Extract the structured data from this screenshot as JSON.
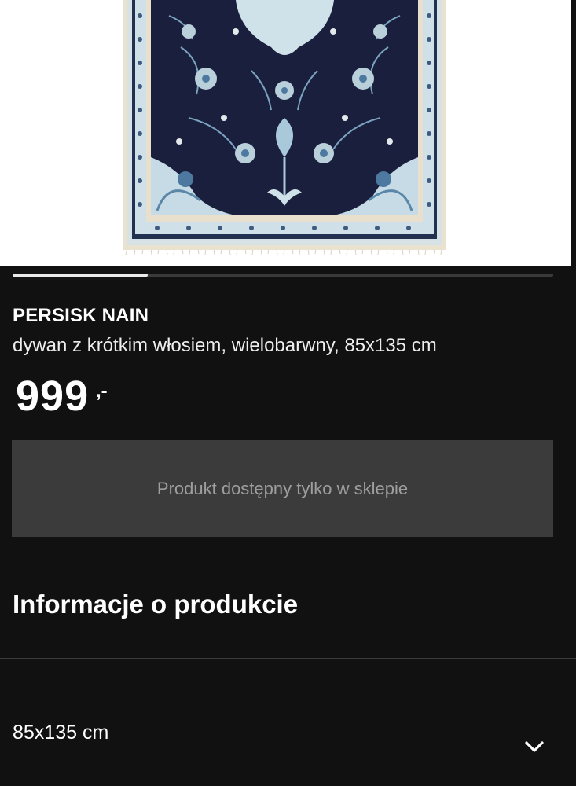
{
  "product": {
    "name": "PERSISK NAIN",
    "description": "dywan z krótkim włosiem, wielobarwny, 85x135 cm",
    "price": "999",
    "price_suffix": ",-"
  },
  "gallery": {
    "image": "rug-photo",
    "progress": 0.25
  },
  "availability": {
    "label": "Produkt dostępny tylko w sklepie"
  },
  "info": {
    "heading": "Informacje o produkcie"
  },
  "size": {
    "label": "85x135 cm",
    "icon": "chevron-down-icon"
  },
  "colors": {
    "background": "#111111",
    "rug_navy": "#1a1f3d",
    "rug_light_blue": "#a9c9db",
    "rug_cream": "#ebe4d2"
  }
}
